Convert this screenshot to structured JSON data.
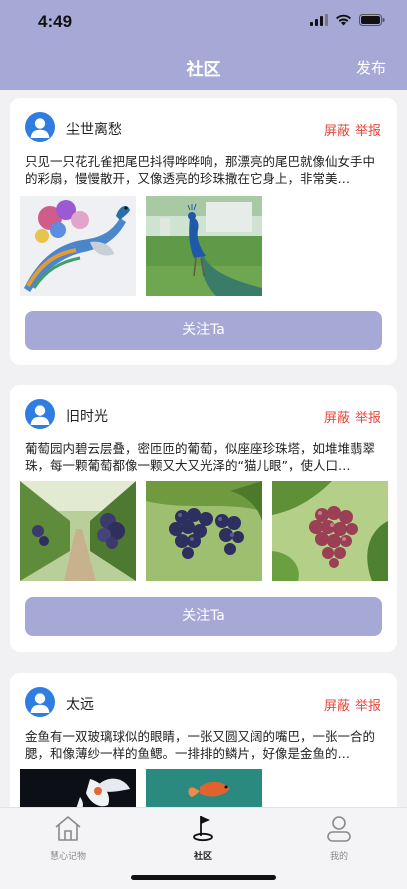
{
  "status_bar": {
    "time": "4:49"
  },
  "nav": {
    "title": "社区",
    "publish_label": "发布"
  },
  "posts": [
    {
      "username": "尘世离愁",
      "block_label": "屏蔽",
      "report_label": "举报",
      "content": "只见一只花孔雀把尾巴抖得哗哗响，那漂亮的尾巴就像仙女手中的彩扇，慢慢散开，又像透亮的珍珠撒在它身上，非常美…",
      "images": [
        "peacock-painting",
        "peacock-on-grass"
      ],
      "follow_label": "关注Ta"
    },
    {
      "username": "旧时光",
      "block_label": "屏蔽",
      "report_label": "举报",
      "content": "葡萄园内碧云层叠，密匝匝的葡萄，似座座珍珠塔，如堆堆翡翠珠，每一颗葡萄都像一颗又大又光泽的“猫儿眼”，使人口…",
      "images": [
        "vineyard-row",
        "dark-grape-cluster",
        "red-grape-cluster"
      ],
      "follow_label": "关注Ta"
    },
    {
      "username": "太远",
      "block_label": "屏蔽",
      "report_label": "举报",
      "content": "金鱼有一双玻璃球似的眼睛，一张又圆又阔的嘴巴，一张一合的腮，和像薄纱一样的鱼鳃。一排排的鳞片，好像是金鱼的…",
      "images": [
        "goldfish-dark",
        "goldfish-teal"
      ],
      "follow_label": "关注Ta"
    }
  ],
  "tabbar": {
    "items": [
      {
        "label": "慧心记物",
        "icon": "home-icon",
        "active": false
      },
      {
        "label": "社区",
        "icon": "golf-flag-icon",
        "active": true
      },
      {
        "label": "我的",
        "icon": "person-icon",
        "active": false
      }
    ]
  },
  "colors": {
    "accent": "#a6a9d6",
    "alert": "#e5483a",
    "avatar": "#2f7de1"
  }
}
